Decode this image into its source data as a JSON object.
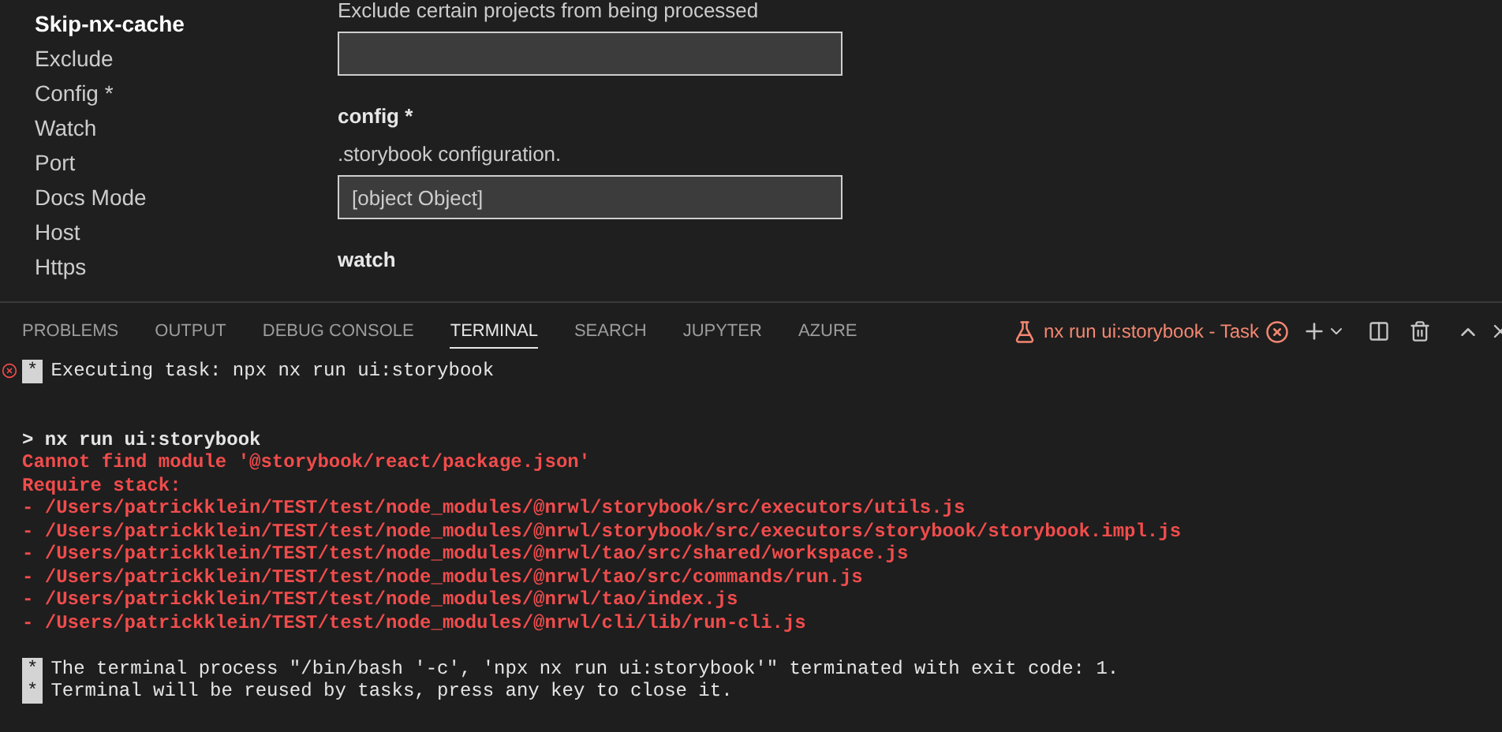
{
  "sidebar": {
    "items": [
      {
        "label": "Skip-nx-cache",
        "selected": true
      },
      {
        "label": "Exclude",
        "selected": false
      },
      {
        "label": "Config *",
        "selected": false
      },
      {
        "label": "Watch",
        "selected": false
      },
      {
        "label": "Port",
        "selected": false
      },
      {
        "label": "Docs Mode",
        "selected": false
      },
      {
        "label": "Host",
        "selected": false
      },
      {
        "label": "Https",
        "selected": false
      }
    ]
  },
  "settings": [
    {
      "kind": "field",
      "description": "Exclude certain projects from being processed"
    },
    {
      "kind": "field",
      "title": "config *",
      "description": ".storybook configuration.",
      "value": "[object Object]"
    },
    {
      "kind": "heading",
      "title": "watch"
    }
  ],
  "panel": {
    "tabs": [
      {
        "label": "PROBLEMS",
        "selected": false
      },
      {
        "label": "OUTPUT",
        "selected": false
      },
      {
        "label": "DEBUG CONSOLE",
        "selected": false
      },
      {
        "label": "TERMINAL",
        "selected": true
      },
      {
        "label": "SEARCH",
        "selected": false
      },
      {
        "label": "JUPYTER",
        "selected": false
      },
      {
        "label": "AZURE",
        "selected": false
      }
    ],
    "task_name": "nx run ui:storybook - Task"
  },
  "terminal": [
    {
      "kind": "task",
      "failed": true,
      "mark": "*",
      "text": "Executing task: npx nx run ui:storybook"
    },
    {
      "kind": "blank"
    },
    {
      "kind": "blank"
    },
    {
      "kind": "command",
      "text": "> nx run ui:storybook"
    },
    {
      "kind": "error",
      "text": "Cannot find module '@storybook/react/package.json'"
    },
    {
      "kind": "error",
      "text": "Require stack:"
    },
    {
      "kind": "error",
      "text": "- /Users/patrickklein/TEST/test/node_modules/@nrwl/storybook/src/executors/utils.js"
    },
    {
      "kind": "error",
      "text": "- /Users/patrickklein/TEST/test/node_modules/@nrwl/storybook/src/executors/storybook/storybook.impl.js"
    },
    {
      "kind": "error",
      "text": "- /Users/patrickklein/TEST/test/node_modules/@nrwl/tao/src/shared/workspace.js"
    },
    {
      "kind": "error",
      "text": "- /Users/patrickklein/TEST/test/node_modules/@nrwl/tao/src/commands/run.js"
    },
    {
      "kind": "error",
      "text": "- /Users/patrickklein/TEST/test/node_modules/@nrwl/tao/index.js"
    },
    {
      "kind": "error",
      "text": "- /Users/patrickklein/TEST/test/node_modules/@nrwl/cli/lib/run-cli.js"
    },
    {
      "kind": "blank"
    },
    {
      "kind": "task",
      "failed": false,
      "mark": "*",
      "text": "The terminal process \"/bin/bash '-c', 'npx nx run ui:storybook'\" terminated with exit code: 1."
    },
    {
      "kind": "task",
      "failed": false,
      "mark": "*",
      "text": "Terminal will be reused by tasks, press any key to close it."
    }
  ]
}
